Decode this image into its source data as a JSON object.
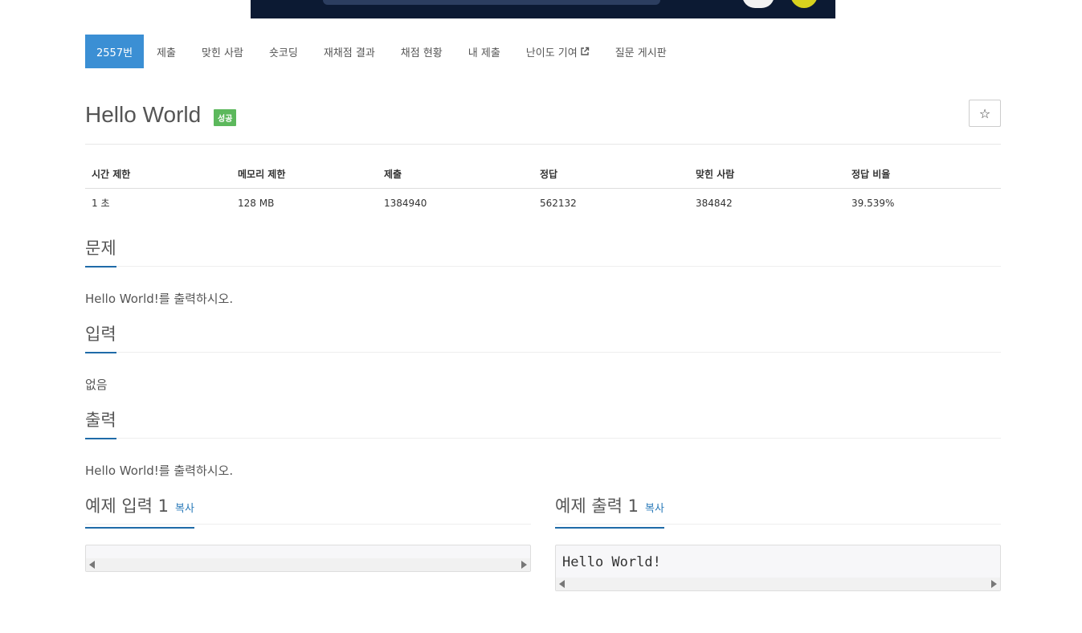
{
  "nav": {
    "items": [
      {
        "label": "2557번",
        "active": true
      },
      {
        "label": "제출"
      },
      {
        "label": "맞힌 사람"
      },
      {
        "label": "숏코딩"
      },
      {
        "label": "재채점 결과"
      },
      {
        "label": "채점 현황"
      },
      {
        "label": "내 제출"
      },
      {
        "label": "난이도 기여",
        "icon": "external-link-icon"
      },
      {
        "label": "질문 게시판"
      }
    ]
  },
  "problem": {
    "title": "Hello World",
    "status": "성공",
    "star_icon": "☆"
  },
  "info_table": {
    "headers": [
      "시간 제한",
      "메모리 제한",
      "제출",
      "정답",
      "맞힌 사람",
      "정답 비율"
    ],
    "row": [
      "1 초",
      "128 MB",
      "1384940",
      "562132",
      "384842",
      "39.539%"
    ]
  },
  "sections": {
    "description": {
      "title": "문제",
      "body": "Hello World!를 출력하시오."
    },
    "input": {
      "title": "입력",
      "body": "없음"
    },
    "output": {
      "title": "출력",
      "body": "Hello World!를 출력하시오."
    }
  },
  "samples": {
    "input": {
      "title": "예제 입력 1",
      "copy_label": "복사",
      "content": ""
    },
    "output": {
      "title": "예제 출력 1",
      "copy_label": "복사",
      "content": "Hello World!"
    }
  },
  "colors": {
    "accent": "#3b8fd4",
    "success": "#5cb85c",
    "underline": "#1f6ba8"
  }
}
